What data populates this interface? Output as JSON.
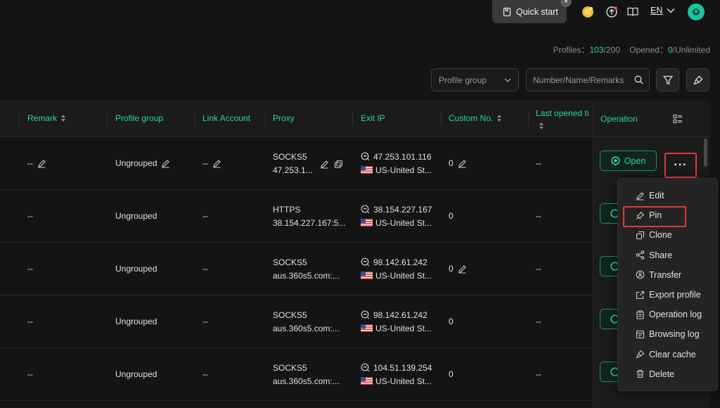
{
  "topbar": {
    "quick_start": "Quick start",
    "lang": "EN"
  },
  "stats": {
    "profiles_label": "Profiles：",
    "profiles_used": "103",
    "profiles_total": "/200",
    "opened_label": "Opened：",
    "opened_count": "0",
    "opened_total": "/Unlimited"
  },
  "filters": {
    "profile_group_placeholder": "Profile group",
    "search_placeholder": "Number/Name/Remarks"
  },
  "columns": {
    "remark": "Remark",
    "profile_group": "Profile group",
    "link_account": "Link Account",
    "proxy": "Proxy",
    "exit_ip": "Exit IP",
    "custom_no": "Custom No.",
    "last_opened": "Last opened ti",
    "operation": "Operation"
  },
  "rows": [
    {
      "remark": "--",
      "group": "Ungrouped",
      "link": "--",
      "proxy_type": "SOCKS5",
      "proxy_addr": "47.253.1...",
      "ip": "47.253.101.116",
      "country": "US-United St...",
      "custom": "0",
      "last": "--"
    },
    {
      "remark": "--",
      "group": "Ungrouped",
      "link": "--",
      "proxy_type": "HTTPS",
      "proxy_addr": "38.154.227.167:5...",
      "ip": "38.154.227.167",
      "country": "US-United St...",
      "custom": "0",
      "last": "--"
    },
    {
      "remark": "--",
      "group": "Ungrouped",
      "link": "--",
      "proxy_type": "SOCKS5",
      "proxy_addr": "aus.360s5.com:...",
      "ip": "98.142.61.242",
      "country": "US-United St...",
      "custom": "0",
      "last": "--"
    },
    {
      "remark": "--",
      "group": "Ungrouped",
      "link": "--",
      "proxy_type": "SOCKS5",
      "proxy_addr": "aus.360s5.com:...",
      "ip": "98.142.61.242",
      "country": "US-United St...",
      "custom": "0",
      "last": "--"
    },
    {
      "remark": "--",
      "group": "Ungrouped",
      "link": "--",
      "proxy_type": "SOCKS5",
      "proxy_addr": "aus.360s5.com:...",
      "ip": "104.51.139.254",
      "country": "US-United St...",
      "custom": "0",
      "last": "--"
    }
  ],
  "open_label": "Open",
  "more_label": "···",
  "menu": [
    "Edit",
    "Pin",
    "Clone",
    "Share",
    "Transfer",
    "Export profile",
    "Operation log",
    "Browsing log",
    "Clear cache",
    "Delete"
  ],
  "colors": {
    "accent": "#2bd6a0",
    "highlight": "#e0393e",
    "background": "#141414"
  }
}
